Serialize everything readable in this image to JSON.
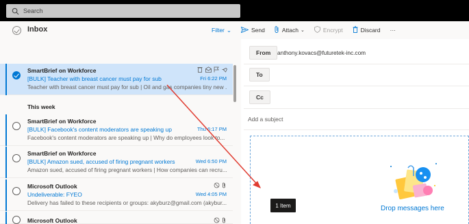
{
  "search": {
    "placeholder": "Search"
  },
  "list": {
    "title": "Inbox",
    "filter_label": "Filter",
    "section_label": "This week",
    "messages": [
      {
        "sender": "SmartBrief on Workforce",
        "subject": "[BULK] Teacher with breast cancer must pay for sub",
        "time": "Fri 6:22 PM",
        "preview": "Teacher with breast cancer must pay for sub | Oil and gas companies tiny new ..."
      },
      {
        "sender": "SmartBrief on Workforce",
        "subject": "[BULK] Facebook's content moderators are speaking up",
        "time": "Thu 6:17 PM",
        "preview": "Facebook's content moderators are speaking up | Why do employees look to..."
      },
      {
        "sender": "SmartBrief on Workforce",
        "subject": "[BULK] Amazon sued, accused of firing pregnant workers",
        "time": "Wed 6:50 PM",
        "preview": "Amazon sued, accused of firing pregnant workers | How companies can recru..."
      },
      {
        "sender": "Microsoft Outlook",
        "subject": "Undeliverable: FYEO",
        "time": "Wed 4:05 PM",
        "preview": "Delivery has failed to these recipients or groups: akyburz@gmail.com (akybur..."
      },
      {
        "sender": "Microsoft Outlook",
        "subject": "",
        "time": "",
        "preview": ""
      }
    ]
  },
  "compose": {
    "toolbar": {
      "send": "Send",
      "attach": "Attach",
      "encrypt": "Encrypt",
      "discard": "Discard",
      "more": "···"
    },
    "from_label": "From",
    "from_value": "anthony.kovacs@futuretek-inc.com",
    "to_label": "To",
    "cc_label": "Cc",
    "subject_placeholder": "Add a subject",
    "drop_text": "Drop messages here"
  },
  "drag": {
    "tooltip": "1 Item"
  },
  "colors": {
    "accent": "#0078d4",
    "selected": "#cfe4fa",
    "topbar": "#000000",
    "arrow": "#e03c31"
  }
}
